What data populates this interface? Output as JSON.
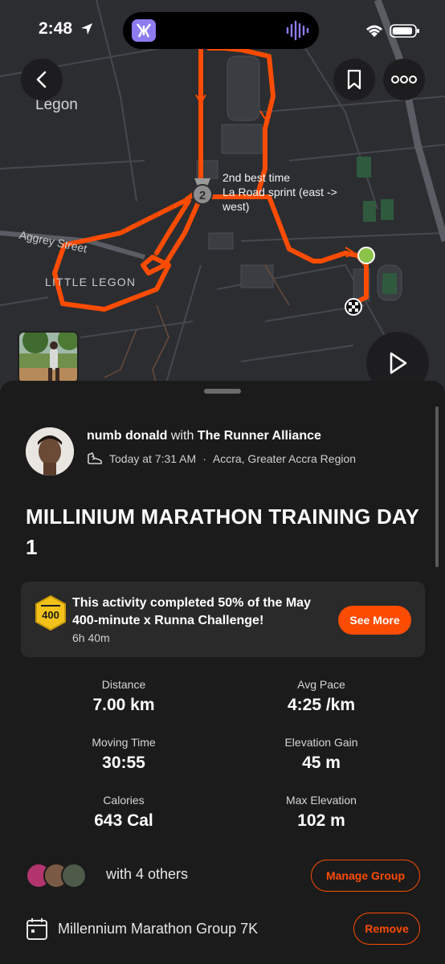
{
  "status_bar": {
    "time": "2:48"
  },
  "map": {
    "place_labels": {
      "legon": "Legon",
      "aggrey_street": "Aggrey Street",
      "little_legon": "LITTLE LEGON"
    },
    "segment_callout": {
      "rank": "2",
      "line1": "2nd best time",
      "line2": "La Road sprint (east ->",
      "line3": "west)"
    },
    "colors": {
      "route": "#fc4c02",
      "start": "#8bc34a",
      "background": "#2b2d31"
    }
  },
  "athlete": {
    "name": "numb donald",
    "with_text": "with",
    "club": "The Runner Alliance",
    "timestamp": "Today at 7:31 AM",
    "location": "Accra, Greater Accra Region",
    "separator": "·"
  },
  "activity": {
    "title": "MILLINIUM MARATHON TRAINING DAY 1"
  },
  "challenge": {
    "badge_text": "400",
    "text": "This activity completed 50% of the May 400-minute x Runna Challenge!",
    "time": "6h 40m",
    "button_label": "See More"
  },
  "stats": [
    {
      "label": "Distance",
      "value": "7.00 km"
    },
    {
      "label": "Avg Pace",
      "value": "4:25 /km"
    },
    {
      "label": "Moving Time",
      "value": "30:55"
    },
    {
      "label": "Elevation Gain",
      "value": "45 m"
    },
    {
      "label": "Calories",
      "value": "643 Cal"
    },
    {
      "label": "Max Elevation",
      "value": "102 m"
    }
  ],
  "group": {
    "text": "with 4 others",
    "button_label": "Manage Group"
  },
  "route": {
    "name": "Millennium Marathon Group 7K",
    "button_label": "Remove"
  },
  "accent_color": "#fc4c02"
}
